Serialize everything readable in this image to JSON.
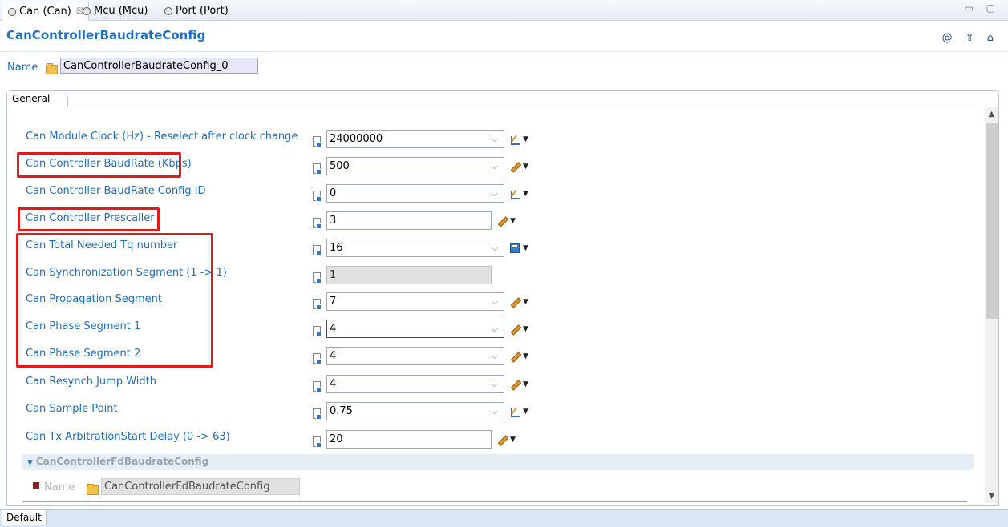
{
  "tabs": [
    {
      "label": "Can (Can)",
      "active": true,
      "close": "☒"
    },
    {
      "label": "Mcu (Mcu)",
      "active": false
    },
    {
      "label": "Port (Port)",
      "active": false
    }
  ],
  "window_buttons": "▭ ▢",
  "header": {
    "title": "CanControllerBaudrateConfig",
    "icons": "@ ⇧ ⌂"
  },
  "name": {
    "label": "Name",
    "value": "CanControllerBaudrateConfig_0"
  },
  "group_tab": "General",
  "rows": [
    {
      "label": "Can Module Clock (Hz) - Reselect after clock change",
      "value": "24000000",
      "type": "combo",
      "action": "calc"
    },
    {
      "label": "Can Controller BaudRate (Kbps)",
      "value": "500",
      "type": "combo",
      "action": "pencil"
    },
    {
      "label": "Can Controller BaudRate Config ID",
      "value": "0",
      "type": "combo",
      "action": "calc"
    },
    {
      "label": "Can Controller Prescaller",
      "value": "3",
      "type": "text",
      "action": "pencil"
    },
    {
      "label": "Can Total Needed Tq number",
      "value": "16",
      "type": "combo",
      "action": "save"
    },
    {
      "label": "Can Synchronization Segment (1 -> 1)",
      "value": "1",
      "type": "disabled",
      "action": "none"
    },
    {
      "label": "Can Propagation Segment",
      "value": "7",
      "type": "combo",
      "action": "pencil"
    },
    {
      "label": "Can Phase Segment 1",
      "value": "4",
      "type": "combo-focused",
      "action": "pencil"
    },
    {
      "label": "Can Phase Segment 2",
      "value": "4",
      "type": "combo",
      "action": "pencil"
    },
    {
      "label": "Can Resynch Jump Width",
      "value": "4",
      "type": "combo",
      "action": "pencil"
    },
    {
      "label": "Can Sample Point",
      "value": "0.75",
      "type": "combo",
      "action": "calc"
    },
    {
      "label": "Can Tx ArbitrationStart Delay (0 -> 63)",
      "value": "20",
      "type": "text",
      "action": "pencil"
    }
  ],
  "subsection": {
    "title": "CanControllerFdBaudrateConfig",
    "name_label": "Name",
    "name_value": "CanControllerFdBaudrateConfig"
  },
  "bottom_tab": "Default",
  "colors": {
    "label_blue": "#1d6ec2",
    "highlight_red": "#e01b1b"
  }
}
